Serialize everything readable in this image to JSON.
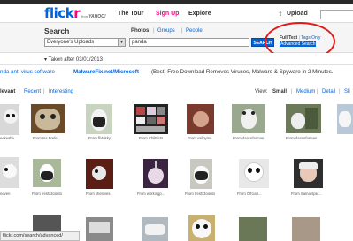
{
  "header": {
    "logo_flick": "flick",
    "logo_r": "r",
    "logo_from": "from",
    "logo_yahoo": "YAHOO!",
    "nav": {
      "tour": "The Tour",
      "signup": "Sign Up",
      "explore": "Explore",
      "upload": "Upload"
    },
    "upload_icon": "upload-arrow-icon"
  },
  "search": {
    "title": "Search",
    "scope": "Everyone's Uploads",
    "tabs": {
      "photos": "Photos",
      "groups": "Groups",
      "people": "People",
      "sep": "|"
    },
    "query": "panda",
    "button": "SEARCH",
    "full_text": "Full Text",
    "tags_only": "Tags Only",
    "sep": "|",
    "advanced": "Advanced Search"
  },
  "filter": {
    "text": "▾ Taken after 03/01/2013"
  },
  "ad": {
    "prefix": "nda anti virus software",
    "sponsor": "MalwareFix.net/Microsoft",
    "text": "(Best) Free Download Removes Viruses, Malware & Spyware in 2 Minutes."
  },
  "sort": {
    "relevant": "levant",
    "recent": "Recent",
    "interesting": "Interesting",
    "sep": "|"
  },
  "view": {
    "label": "View:",
    "small": "Small",
    "medium": "Medium",
    "detail": "Detail",
    "slideshow": "Sli"
  },
  "photos": {
    "row1": [
      {
        "caption": "eekesha"
      },
      {
        "caption": "From Isa Prefe..."
      },
      {
        "caption": "From fliddsky"
      },
      {
        "caption": "From ChilPicts"
      },
      {
        "caption": "From vailbyme"
      },
      {
        "caption": "From dancefarman"
      },
      {
        "caption": "From dancefarman"
      },
      {
        "caption": ""
      }
    ],
    "row2": [
      {
        "caption": "neveri"
      },
      {
        "caption": "From tresfx3oonto"
      },
      {
        "caption": "From sheloves"
      },
      {
        "caption": "From workingp..."
      },
      {
        "caption": "From tresfx3oonto"
      },
      {
        "caption": "From OffcialI..."
      },
      {
        "caption": "From Samarspef..."
      }
    ]
  },
  "status_bar": {
    "url": "flickr.com/search/advanced/"
  }
}
